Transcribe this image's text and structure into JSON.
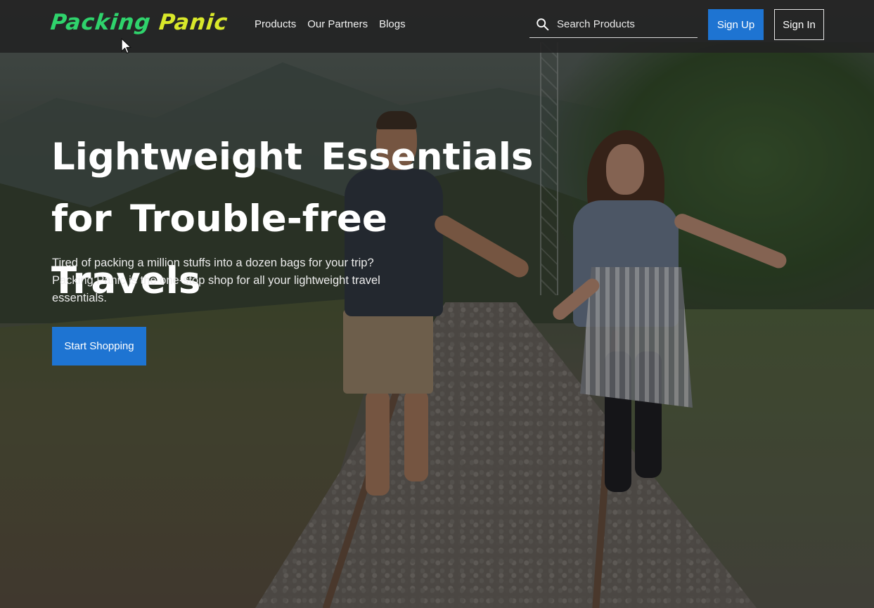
{
  "brand": {
    "logo_word1": "Packing",
    "logo_word2": "Panic",
    "logo_color1": "#2fd36c",
    "logo_color2": "#d9e82a"
  },
  "nav": {
    "links": [
      {
        "label": "Products"
      },
      {
        "label": "Our Partners"
      },
      {
        "label": "Blogs"
      }
    ]
  },
  "search": {
    "icon": "search-icon",
    "placeholder": "Search Products",
    "value": ""
  },
  "auth": {
    "signup_label": "Sign Up",
    "signin_label": "Sign In",
    "accent_color": "#1e74d2"
  },
  "hero": {
    "title_line1": "Lightweight Essentials",
    "title_line2": "for Trouble-free Travels",
    "subtitle": "Tired of packing a million stuffs into a dozen bags for your trip? Packing Panic is the one-stop shop for all your lightweight travel essentials.",
    "cta_label": "Start Shopping"
  }
}
